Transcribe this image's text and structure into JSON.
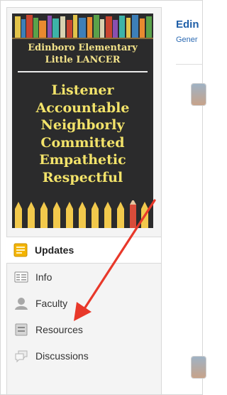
{
  "poster": {
    "school_line1": "Edinboro Elementary",
    "school_line2": "Little LANCER",
    "values": [
      "Listener",
      "Accountable",
      "Neighborly",
      "Committed",
      "Empathetic",
      "Respectful"
    ]
  },
  "nav": {
    "items": [
      {
        "label": "Updates",
        "icon": "updates-icon",
        "active": true
      },
      {
        "label": "Info",
        "icon": "info-icon"
      },
      {
        "label": "Faculty",
        "icon": "faculty-icon"
      },
      {
        "label": "Resources",
        "icon": "resources-icon"
      },
      {
        "label": "Discussions",
        "icon": "discussions-icon"
      }
    ]
  },
  "main": {
    "title": "Edin",
    "subtitle": "Gener"
  },
  "colors": {
    "accent": "#1f5fa8",
    "arrow": "#e8382a",
    "poster_bg": "#2b2b2c",
    "poster_text": "#f3e36a"
  }
}
